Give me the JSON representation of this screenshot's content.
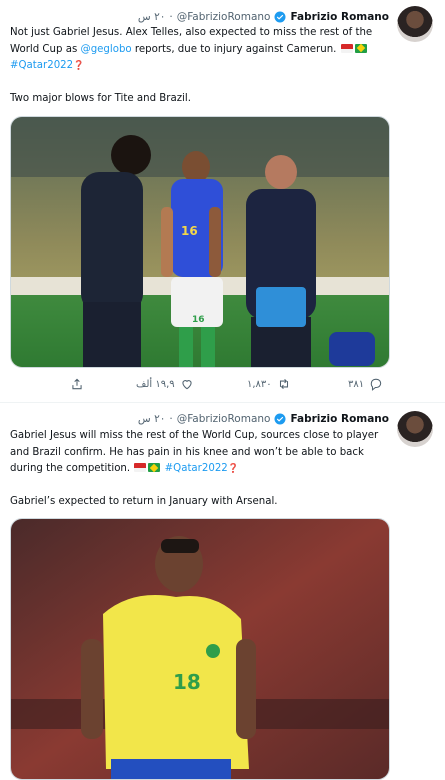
{
  "tweets": [
    {
      "author_name": "Fabrizio Romano",
      "author_handle": "@FabrizioRomano",
      "time": "٢٠ س",
      "text_a": "Not just Gabriel Jesus. Alex Telles, also expected to miss the rest of the World Cup as ",
      "mention": "@geglobo",
      "text_b": " reports, due to injury against Camerun.",
      "hashtag": "#Qatar2022",
      "text_c": "Two major blows for Tite and Brazil.",
      "replies": "٣٨١",
      "retweets": "١,٨٣٠",
      "likes": "١٩,٩ ألف"
    },
    {
      "author_name": "Fabrizio Romano",
      "author_handle": "@FabrizioRomano",
      "time": "٢٠ س",
      "text_a": "Gabriel Jesus will miss the rest of the World Cup, sources close to player and Brazil confirm. He has pain in his knee and won’t be able to back during the competition.",
      "hashtag": "#Qatar2022",
      "text_c": "Gabriel’s expected to return in January with Arsenal."
    }
  ],
  "photo1": {
    "shirt_number_left": "16",
    "shirt_number_short": "16"
  },
  "photo2": {
    "shirt_number": "18"
  },
  "icons": {
    "verified": "verified-badge-icon",
    "reply": "reply-icon",
    "retweet": "retweet-icon",
    "like": "heart-icon",
    "share": "share-icon"
  },
  "colors": {
    "link": "#1d9bf0",
    "verified": "#1d9bf0",
    "text": "#0f1419",
    "muted": "#536471"
  }
}
